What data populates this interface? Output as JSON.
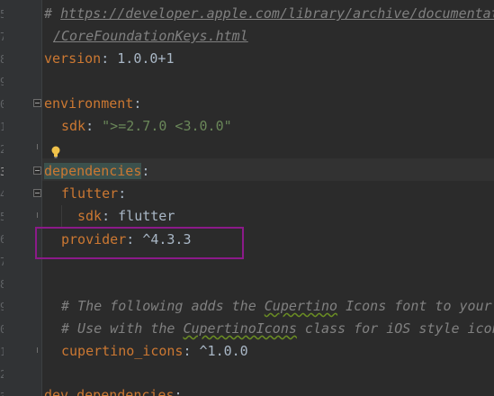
{
  "gutter": {
    "line_digits": [
      "5",
      "7",
      "8",
      "9",
      "0",
      "1",
      "2",
      "3",
      "4",
      "5",
      "6",
      "7",
      "8",
      "9",
      "0",
      "1",
      "2",
      "3"
    ]
  },
  "code": {
    "comment_hash": "# ",
    "doc_url_line1": "https://developer.apple.com/library/archive/documentat",
    "doc_url_line2": "/CoreFoundationKeys.html",
    "version_key": "version",
    "version_value": "1.0.0+1",
    "environment_key": "environment",
    "sdk_key": "sdk",
    "sdk_value": "\">=2.7.0 <3.0.0\"",
    "dependencies_key": "dependencies",
    "flutter_key": "flutter",
    "flutter_sdk_key": "sdk",
    "flutter_sdk_value": "flutter",
    "provider_key": "provider",
    "provider_value": "^4.3.3",
    "comment1_a": "# The following adds the ",
    "comment1_b": "Cupertino",
    "comment1_c": " Icons font to your",
    "comment2_a": "# Use with the ",
    "comment2_b": "CupertinoIcons",
    "comment2_c": " class for iOS style icon",
    "cupertino_key": "cupertino_icons",
    "cupertino_value": "^1.0.0",
    "dev_dependencies_key": "dev_dependencies"
  },
  "colors": {
    "background": "#2b2b2b",
    "key": "#cc7832",
    "string": "#6a8759",
    "comment": "#808080",
    "text": "#a9b7c6",
    "annotation_box": "#8b1a89"
  },
  "icons": {
    "intention_bulb": "lightbulb-icon",
    "fold_marker": "fold-icon"
  }
}
